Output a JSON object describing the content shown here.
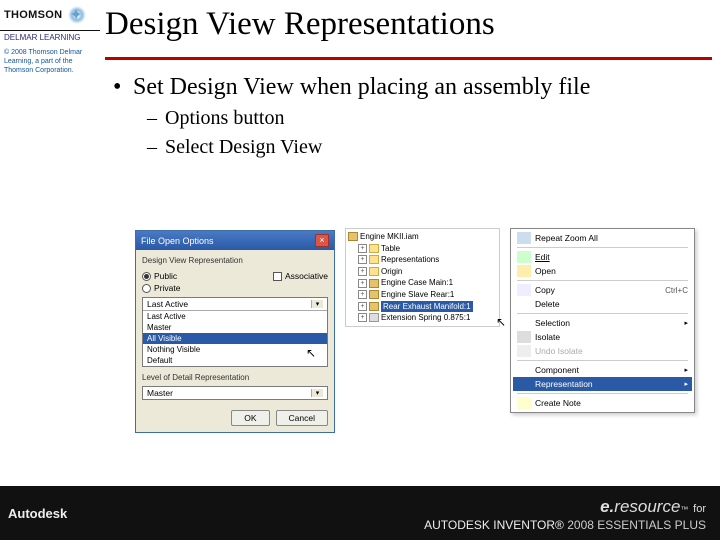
{
  "branding": {
    "publisher": "THOMSON",
    "imprint": "DELMAR LEARNING",
    "copyright": "© 2008 Thomson Delmar Learning, a part of the Thomson Corporation."
  },
  "slide": {
    "title": "Design View Representations",
    "bullet_main": "Set Design View when placing an assembly file",
    "sub1": "Options button",
    "sub2": "Select Design View"
  },
  "dialog": {
    "title": "File Open Options",
    "group_label": "Design View Representation",
    "radio_public": "Public",
    "radio_private": "Private",
    "chk_assoc": "Associative",
    "combo_value": "Last Active",
    "list": [
      "Last Active",
      "Master",
      "All Visible",
      "Nothing Visible",
      "Default"
    ],
    "lod_label": "Level of Detail Representation",
    "lod_value": "Master",
    "ok": "OK",
    "cancel": "Cancel"
  },
  "tree": {
    "root": "Engine MKII.iam",
    "items": [
      "Table",
      "Representations",
      "Origin",
      "Engine Case Main:1",
      "Engine Slave Rear:1",
      "Rear Exhaust Manifold:1",
      "Extension Spring 0.875:1"
    ]
  },
  "menu": {
    "repeat": "Repeat Zoom All",
    "edit": "Edit",
    "open": "Open",
    "copy": "Copy",
    "copy_short": "Ctrl+C",
    "delete": "Delete",
    "selection": "Selection",
    "isolate": "Isolate",
    "undo_isolate": "Undo Isolate",
    "component": "Component",
    "representation": "Representation",
    "create_note": "Create Note"
  },
  "footer": {
    "autodesk": "Autodesk",
    "eresource_prefix": "e.",
    "eresource_word": "resource",
    "eresource_tm": "™",
    "for": "for",
    "product": "AUTODESK INVENTOR®",
    "tagline": "2008 ESSENTIALS PLUS"
  }
}
